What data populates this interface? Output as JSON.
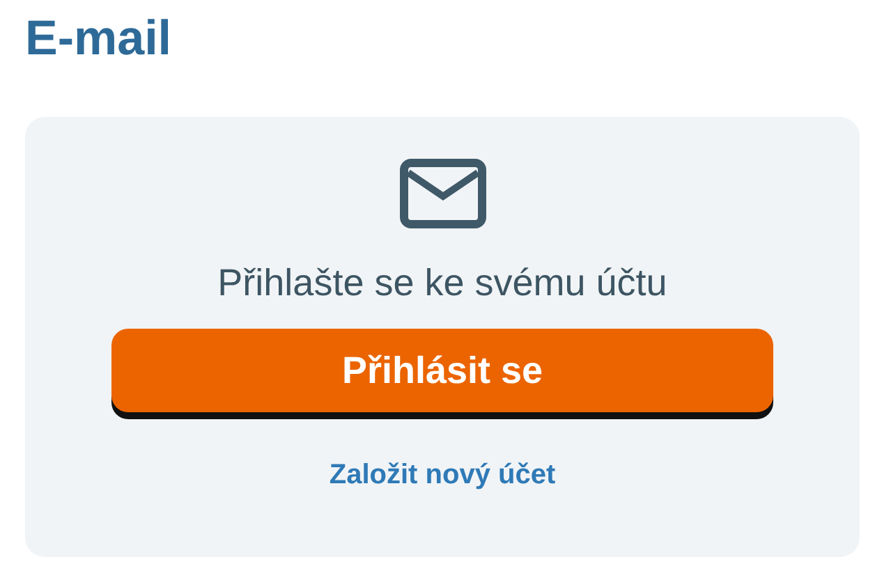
{
  "heading": "E-mail",
  "card": {
    "prompt": "Přihlašte se ke svému účtu",
    "login_button": "Přihlásit se",
    "register_link": "Založit nový účet"
  }
}
